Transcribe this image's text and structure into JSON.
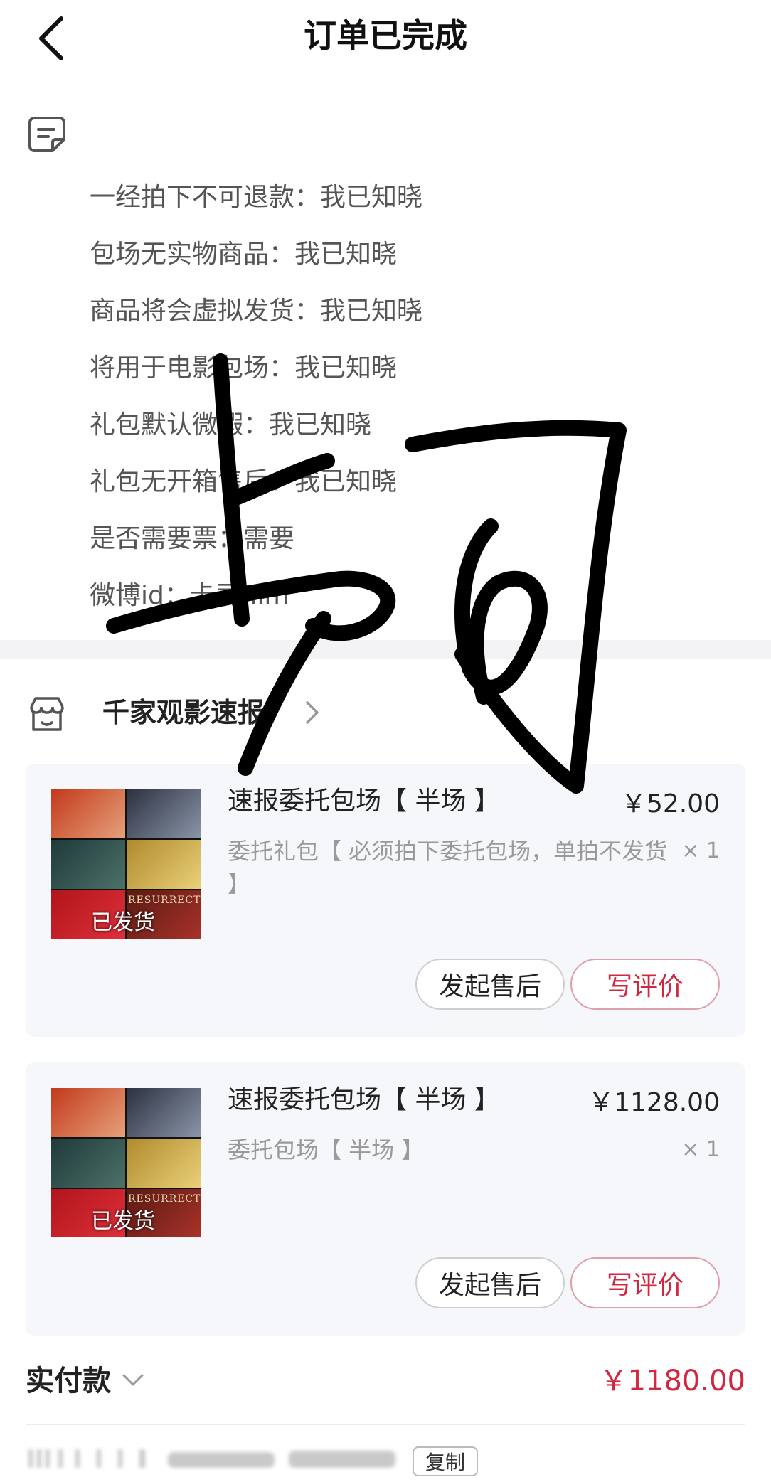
{
  "header": {
    "title": "订单已完成",
    "back_icon": "chevron-left-icon"
  },
  "notes": {
    "icon": "note-icon",
    "lines": [
      "一经拍下不可退款：我已知晓",
      "包场无实物商品：我已知晓",
      "商品将会虚拟发货：我已知晓",
      "将用于电影包场：我已知晓",
      "礼包默认微暇：我已知晓",
      "礼包无开箱售后：我已知晓",
      "是否需要票：需要",
      "微博id：卡司film"
    ]
  },
  "store": {
    "name": "千家观影速报",
    "icon": "store-icon"
  },
  "products": [
    {
      "thumb_tag": "已发货",
      "thumb_text": "RESURRECTION",
      "title": "速报委托包场【 半场 】",
      "price": "￥52.00",
      "subtitle": "委托礼包【 必须拍下委托包场，单拍不发货 】",
      "qty": "× 1",
      "after_sale_label": "发起售后",
      "review_label": "写评价"
    },
    {
      "thumb_tag": "已发货",
      "thumb_text": "RESURRECTION",
      "title": "速报委托包场【 半场 】",
      "price": "￥1128.00",
      "subtitle": "委托包场【 半场 】",
      "qty": "× 1",
      "after_sale_label": "发起售后",
      "review_label": "写评价"
    }
  ],
  "total": {
    "label": "实付款",
    "amount": "￥1180.00"
  },
  "order": {
    "copy_label": "复制"
  },
  "colors": {
    "accent": "#d1283f",
    "muted": "#9a9a9a",
    "card_bg": "#f6f7fa"
  }
}
